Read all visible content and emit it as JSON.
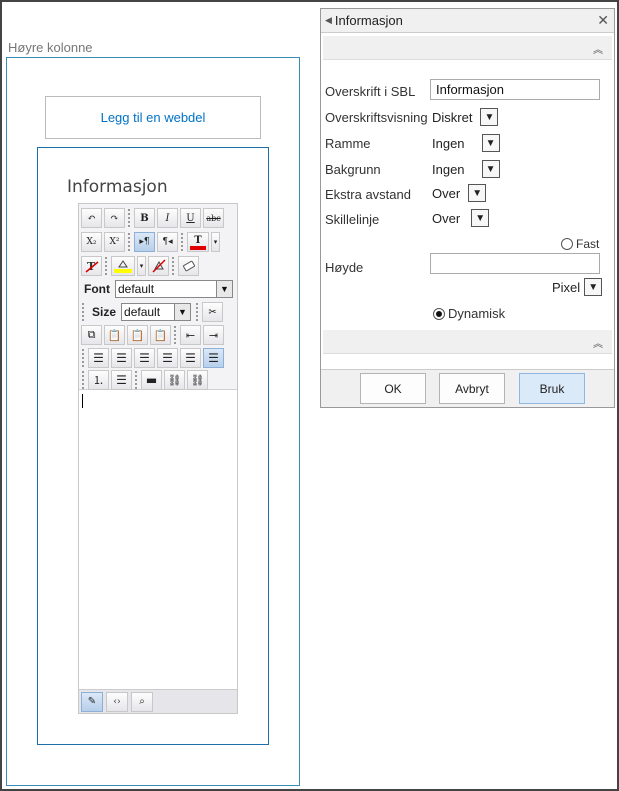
{
  "left": {
    "column_title": "Høyre kolonne",
    "add_webpart": "Legg til en webdel",
    "webpart_title": "Informasjon"
  },
  "editor": {
    "font_label": "Font",
    "font_value": "default",
    "size_label": "Size",
    "size_value": "default",
    "icons": [
      "undo-icon",
      "redo-icon",
      "bold-icon",
      "italic-icon",
      "underline-icon",
      "strikethrough-icon",
      "subscript-icon",
      "superscript-icon",
      "ltr-icon",
      "rtl-icon",
      "font-color-icon",
      "clear-format-icon",
      "highlight-icon",
      "remove-highlight-icon",
      "eraser-icon",
      "cut-icon",
      "copy-icon",
      "paste-icon",
      "paste-text-icon",
      "paste-word-icon",
      "outdent-icon",
      "indent-icon",
      "paragraph-icon",
      "align-left-icon",
      "align-center-icon",
      "align-right-icon",
      "justify-icon",
      "justify-full-icon",
      "ordered-list-icon",
      "unordered-list-icon",
      "horizontal-rule-icon",
      "link-icon",
      "unlink-icon",
      "design-mode-icon",
      "html-mode-icon",
      "preview-mode-icon"
    ],
    "glyphs": {
      "bold": "B",
      "italic": "I",
      "underline": "U",
      "strike": "abc",
      "sub": "X₂",
      "sup": "X²",
      "ltr": "▸¶",
      "rtl": "¶◂",
      "fontcolor": "T"
    }
  },
  "panel": {
    "title": "Informasjon",
    "fields": {
      "overskrift_label": "Overskrift i SBL",
      "overskrift_value": "Informasjon",
      "visning_label": "Overskriftsvisning",
      "visning_value": "Diskret",
      "ramme_label": "Ramme",
      "ramme_value": "Ingen",
      "bakgrunn_label": "Bakgrunn",
      "bakgrunn_value": "Ingen",
      "avstand_label": "Ekstra avstand",
      "avstand_value": "Over",
      "skille_label": "Skillelinje",
      "skille_value": "Over",
      "fast_label": "Fast",
      "hoyde_label": "Høyde",
      "hoyde_value": "",
      "unit_value": "Pixel",
      "dynamisk_label": "Dynamisk"
    },
    "buttons": {
      "ok": "OK",
      "cancel": "Avbryt",
      "apply": "Bruk"
    }
  },
  "colors": {
    "zone_border": "#1e6fa8",
    "link": "#0072c6",
    "font_color_bar": "#e00000",
    "highlight_bar": "#ffff00"
  }
}
